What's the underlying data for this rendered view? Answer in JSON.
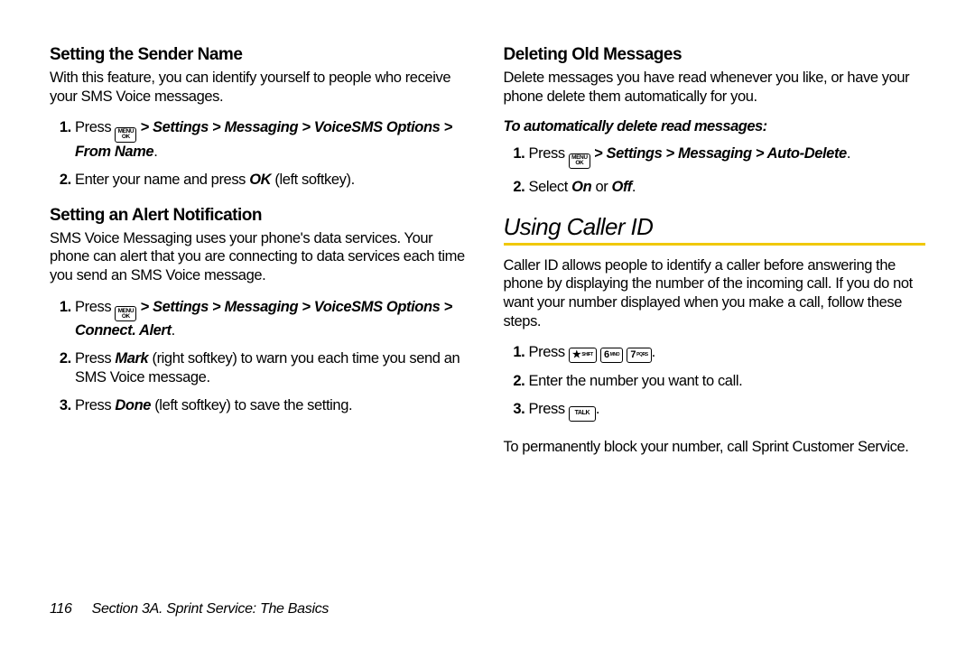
{
  "left": {
    "h1": "Setting the Sender Name",
    "p1": "With this feature, you can identify yourself to people who receive your SMS Voice messages.",
    "l1a": "Press ",
    "l1b": " > Settings > Messaging > VoiceSMS Options > From Name",
    "l1c": ".",
    "l2a": "Enter your name and press ",
    "l2b": "OK",
    "l2c": " (left softkey).",
    "h2": "Setting an Alert Notification",
    "p2": "SMS Voice Messaging uses your phone's data services. Your phone can alert that you are connecting to data services each time you send an SMS Voice message.",
    "l3a": "Press ",
    "l3b": " > Settings > Messaging > VoiceSMS Options > Connect. Alert",
    "l3c": ".",
    "l4a": "Press ",
    "l4b": "Mark",
    "l4c": " (right softkey) to warn you each time you send an SMS Voice message.",
    "l5a": "Press ",
    "l5b": "Done",
    "l5c": " (left softkey) to save the setting."
  },
  "right": {
    "h1": "Deleting Old Messages",
    "p1": "Delete messages you have read whenever you like, or have your phone delete them automatically for you.",
    "sub": "To automatically delete read messages:",
    "l1a": "Press ",
    "l1b": " > Settings > Messaging > Auto-Delete",
    "l1c": ".",
    "l2a": "Select ",
    "l2b": "On",
    "l2c": " or ",
    "l2d": "Off",
    "l2e": ".",
    "sec": "Using Caller ID",
    "p2": "Caller ID allows people to identify a caller before answering the phone by displaying the number of the incoming call. If you do not want your number displayed when you make a call, follow these steps.",
    "l3": "Press ",
    "l4": "Enter the number you want to call.",
    "l5": "Press ",
    "p3": "To permanently block your number, call Sprint Customer Service."
  },
  "keys": {
    "menu": "MENU",
    "ok": "OK",
    "star": "★",
    "shift": "SHIFT",
    "six": "6",
    "mno": "MNO",
    "seven": "7",
    "pqrs": "PQRS",
    "talk": "TALK"
  },
  "footer": {
    "page": "116",
    "section": "Section 3A. Sprint Service: The Basics"
  }
}
